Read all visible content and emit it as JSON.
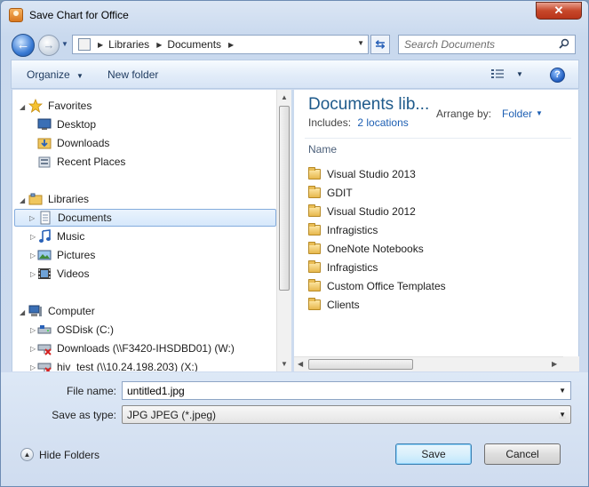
{
  "window": {
    "title": "Save Chart for Office",
    "close_glyph": "✕"
  },
  "address_bar": {
    "path": [
      "Libraries",
      "Documents"
    ],
    "search_placeholder": "Search Documents"
  },
  "toolbar": {
    "organize": "Organize",
    "new_folder": "New folder",
    "help": "?"
  },
  "nav_tree": {
    "favorites": {
      "label": "Favorites",
      "items": [
        "Desktop",
        "Downloads",
        "Recent Places"
      ]
    },
    "libraries": {
      "label": "Libraries",
      "items": [
        "Documents",
        "Music",
        "Pictures",
        "Videos"
      ],
      "selected": "Documents"
    },
    "computer": {
      "label": "Computer",
      "items": [
        "OSDisk (C:)",
        "Downloads (\\\\F3420-IHSDBD01) (W:)",
        "hiv_test (\\\\10.24.198.203) (X:)"
      ]
    }
  },
  "content": {
    "library_title": "Documents lib...",
    "includes_label": "Includes:",
    "includes_link": "2 locations",
    "arrange_label": "Arrange by:",
    "arrange_value": "Folder",
    "column_name": "Name",
    "folders": [
      "Visual Studio 2013",
      "GDIT",
      "Visual Studio 2012",
      "Infragistics",
      "OneNote Notebooks",
      "Infragistics",
      "Custom Office Templates",
      "Clients"
    ]
  },
  "form": {
    "file_name_label": "File name:",
    "file_name_value": "untitled1.jpg",
    "save_type_label": "Save as type:",
    "save_type_value": "JPG JPEG (*.jpeg)"
  },
  "footer": {
    "hide_folders": "Hide Folders",
    "save": "Save",
    "cancel": "Cancel"
  },
  "colors": {
    "accent_title": "#1e5a8b",
    "link": "#1d5fb3",
    "close": "#c7482a"
  }
}
